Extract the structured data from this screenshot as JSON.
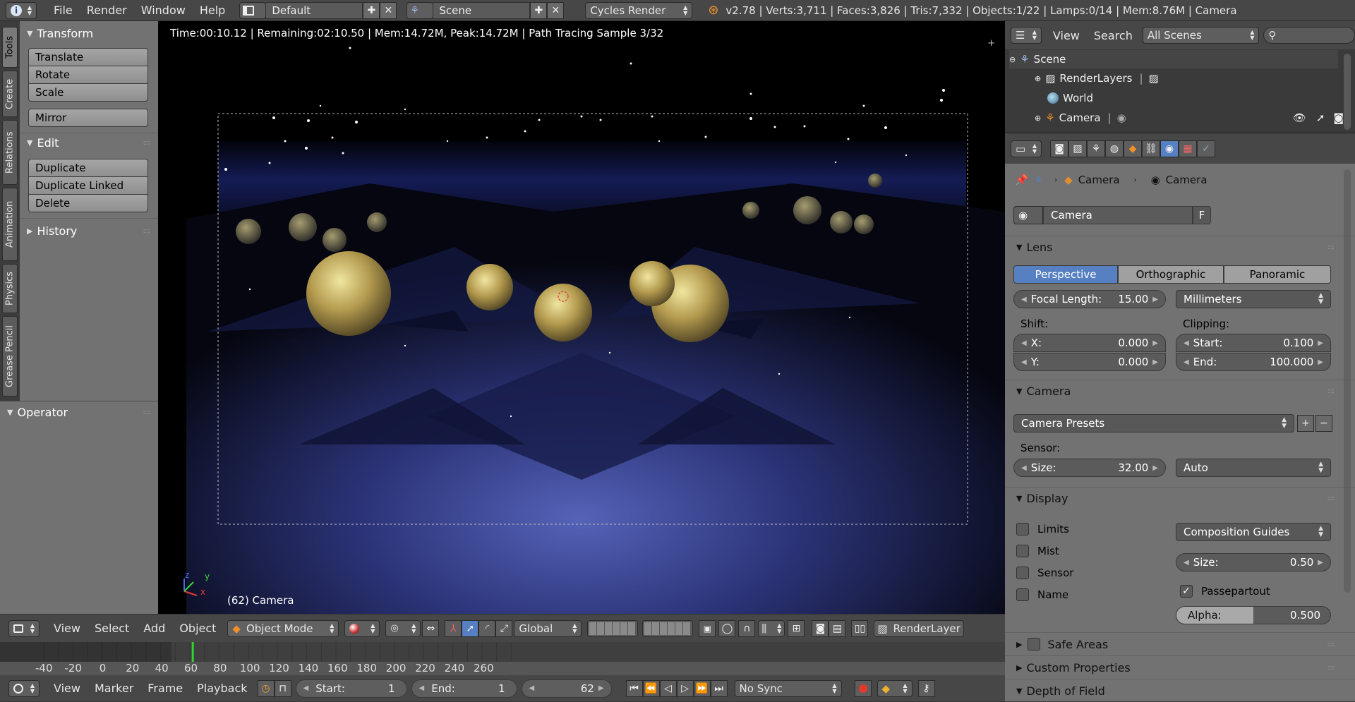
{
  "topbar": {
    "menus": [
      "File",
      "Render",
      "Window",
      "Help"
    ],
    "screen_layout": "Default",
    "scene": "Scene",
    "engine": "Cycles Render",
    "stats": "v2.78 | Verts:3,711 | Faces:3,826 | Tris:7,332 | Objects:1/22 | Lamps:0/14 | Mem:8.76M | Camera"
  },
  "toolshelf": {
    "tabs": [
      "Tools",
      "Create",
      "Relations",
      "Animation",
      "Physics",
      "Grease Pencil"
    ],
    "transform_title": "Transform",
    "translate": "Translate",
    "rotate": "Rotate",
    "scale": "Scale",
    "mirror": "Mirror",
    "edit_title": "Edit",
    "duplicate": "Duplicate",
    "duplicate_linked": "Duplicate Linked",
    "delete": "Delete",
    "history_title": "History",
    "operator_title": "Operator"
  },
  "viewport": {
    "render_stats": "Time:00:10.12 | Remaining:02:10.50 | Mem:14.72M, Peak:14.72M | Path Tracing Sample 3/32",
    "object_label": "(62) Camera",
    "axis_x": "x",
    "axis_y": "y",
    "axis_z": "z"
  },
  "view_header": {
    "view": "View",
    "select": "Select",
    "add": "Add",
    "object": "Object",
    "mode": "Object Mode",
    "orientation": "Global",
    "render_layer": "RenderLayer"
  },
  "timeline": {
    "ticks": [
      "-40",
      "-20",
      "0",
      "20",
      "40",
      "60",
      "80",
      "100",
      "120",
      "140",
      "160",
      "180",
      "200",
      "220",
      "240",
      "260"
    ],
    "current_frame_marker": 62,
    "view": "View",
    "marker": "Marker",
    "frame": "Frame",
    "playback": "Playback",
    "start_label": "Start:",
    "start_value": "1",
    "end_label": "End:",
    "end_value": "1",
    "current": "62",
    "sync": "No Sync"
  },
  "outliner": {
    "view": "View",
    "search": "Search",
    "scenes_filter": "All Scenes",
    "items": [
      "Scene",
      "RenderLayers",
      "World",
      "Camera"
    ]
  },
  "properties": {
    "breadcrumb_1": "Camera",
    "breadcrumb_2": "Camera",
    "datablock_name": "Camera",
    "fake_user": "F",
    "lens_title": "Lens",
    "lens_types": [
      "Perspective",
      "Orthographic",
      "Panoramic"
    ],
    "active_lens_type": "Perspective",
    "focal_label": "Focal Length:",
    "focal_value": "15.00",
    "lens_unit": "Millimeters",
    "shift_label": "Shift:",
    "shift_x_label": "X:",
    "shift_x_value": "0.000",
    "shift_y_label": "Y:",
    "shift_y_value": "0.000",
    "clipping_label": "Clipping:",
    "clip_start_label": "Start:",
    "clip_start_value": "0.100",
    "clip_end_label": "End:",
    "clip_end_value": "100.000",
    "camera_title": "Camera",
    "camera_presets": "Camera Presets",
    "sensor_label": "Sensor:",
    "sensor_size_label": "Size:",
    "sensor_size_value": "32.00",
    "sensor_fit": "Auto",
    "display_title": "Display",
    "limits": "Limits",
    "mist": "Mist",
    "sensor": "Sensor",
    "name": "Name",
    "composition_guides": "Composition Guides",
    "display_size_label": "Size:",
    "display_size_value": "0.50",
    "passepartout": "Passepartout",
    "alpha_label": "Alpha:",
    "alpha_value": "0.500",
    "alpha_fraction": 0.5,
    "safe_areas": "Safe Areas",
    "custom_properties": "Custom Properties",
    "depth_of_field": "Depth of Field"
  },
  "colors": {
    "accent_blue": "#5680c2",
    "header_bg": "#474747",
    "panel_bg": "#727272",
    "frame_marker": "#2fd62f"
  }
}
